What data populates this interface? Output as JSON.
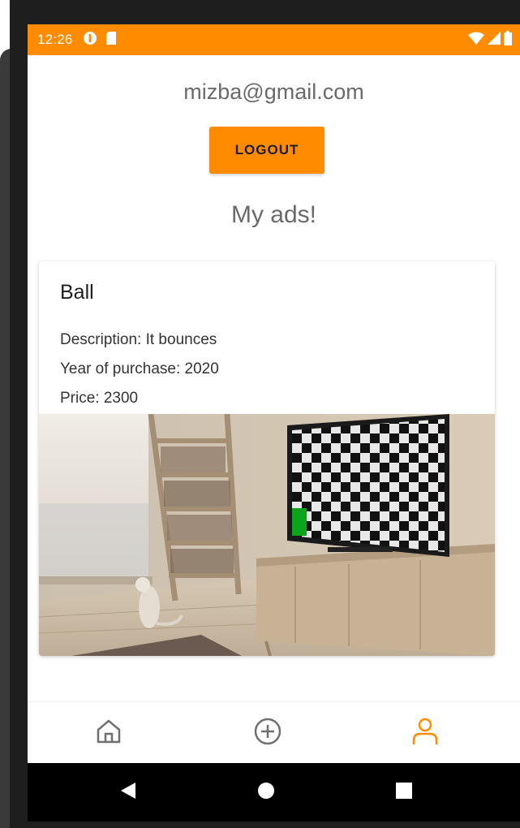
{
  "status_bar": {
    "time": "12:26",
    "background": "#ff8c00"
  },
  "profile": {
    "email": "mizba@gmail.com",
    "logout_label": "LOGOUT",
    "section_title": "My ads!"
  },
  "ads": [
    {
      "title": "Ball",
      "description": "Description: It bounces",
      "year": "Year of purchase: 2020",
      "price": "Price: 2300",
      "image_icon": "ad-photo-image"
    }
  ],
  "bottom_nav": {
    "items": [
      {
        "icon": "home-icon",
        "active": false
      },
      {
        "icon": "add-circle-icon",
        "active": false
      },
      {
        "icon": "profile-icon",
        "active": true
      }
    ],
    "active_color": "#ff8c00",
    "inactive_color": "#6f6f6f"
  },
  "system_nav": {
    "items": [
      "back-icon",
      "home-circle-icon",
      "recents-icon"
    ]
  },
  "colors": {
    "accent": "#ff8c00",
    "text_muted": "#6a6a6a"
  }
}
